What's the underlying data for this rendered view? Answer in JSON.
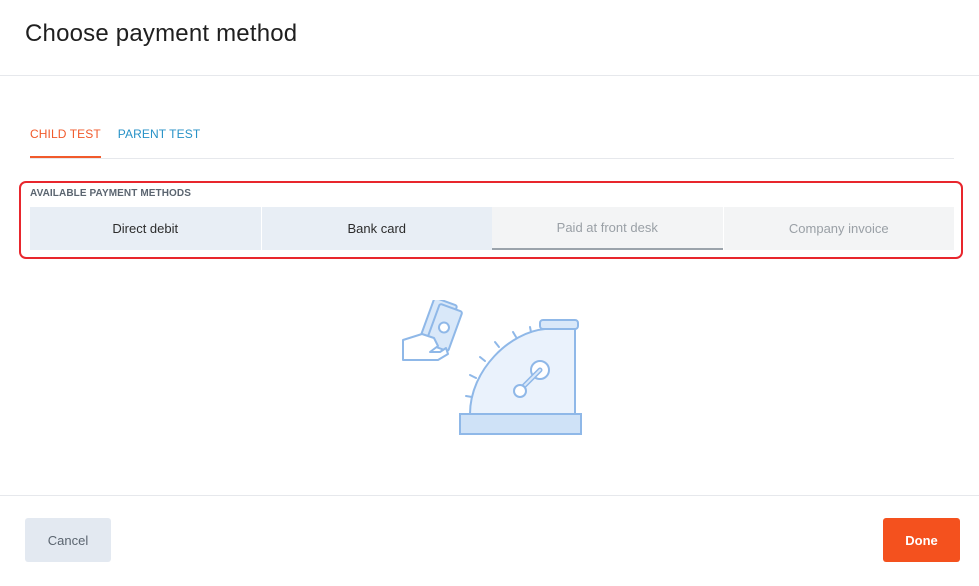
{
  "modal": {
    "title": "Choose payment method"
  },
  "tabs": [
    {
      "label": "CHILD TEST",
      "active": true
    },
    {
      "label": "PARENT TEST",
      "active": false
    }
  ],
  "payment_section": {
    "label": "AVAILABLE PAYMENT METHODS",
    "methods": [
      {
        "label": "Direct debit",
        "enabled": true
      },
      {
        "label": "Bank card",
        "enabled": true
      },
      {
        "label": "Paid at front desk",
        "enabled": false,
        "selected": true
      },
      {
        "label": "Company invoice",
        "enabled": false
      }
    ]
  },
  "illustration": {
    "icon": "cash-register-icon",
    "secondary_icon": "hand-holding-cash-icon"
  },
  "footer": {
    "cancel_label": "Cancel",
    "done_label": "Done"
  },
  "colors": {
    "accent": "#f4511e",
    "active_tab": "#f15a2b",
    "inactive_tab": "#2792c7",
    "highlight_outline": "#e8262d",
    "illustration_stroke": "#8fb8e8",
    "illustration_fill": "#d9e8f9"
  }
}
